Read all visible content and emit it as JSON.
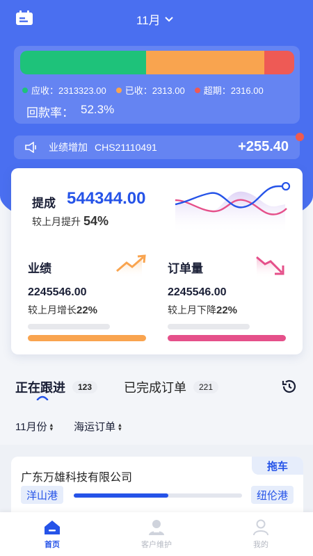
{
  "colors": {
    "primary": "#4a6ff0",
    "accent_blue": "#2553e8",
    "received_green": "#1ec27a",
    "done_orange": "#f9a44f",
    "overdue_red": "#ee5a55",
    "pink": "#e5508a"
  },
  "header": {
    "month_label": "11月",
    "calendar_icon": "calendar-icon",
    "dropdown_icon": "chevron-down-icon"
  },
  "summary": {
    "segments": [
      {
        "name": "应收",
        "value": 2313323.0,
        "display": "2313323.00",
        "color": "#1ec27a"
      },
      {
        "name": "已收",
        "value": 2313.0,
        "display": "2313.00",
        "color": "#f9a44f"
      },
      {
        "name": "超期",
        "value": 2316.0,
        "display": "2316.00",
        "color": "#ee5a55"
      }
    ],
    "bar_fractions": [
      0.46,
      0.43,
      0.11
    ],
    "legend": [
      {
        "label": "应收：",
        "value": "2313323.00",
        "color": "#1ec27a"
      },
      {
        "label": "已收：",
        "value": "2313.00",
        "color": "#f9a44f"
      },
      {
        "label": "超期：",
        "value": "2316.00",
        "color": "#ee5a55"
      }
    ],
    "rate_label": "回款率：",
    "rate_value": "52.3%"
  },
  "notice": {
    "text": "业绩增加",
    "code": "CHS21110491",
    "amount": "+255.40"
  },
  "commission": {
    "label": "提成",
    "value": "544344.00",
    "compare_label": "较上月提升",
    "compare_value": "54%"
  },
  "metrics": [
    {
      "title": "业绩",
      "value": "2245546.00",
      "compare_label": "较上月增长",
      "compare_value": "22%",
      "trend": "up",
      "fill_color": "#f9a44f"
    },
    {
      "title": "订单量",
      "value": "2245546.00",
      "compare_label": "较上月下降",
      "compare_value": "22%",
      "trend": "down",
      "fill_color": "#e5508a"
    }
  ],
  "tabs": [
    {
      "label": "正在跟进",
      "count": "123",
      "active": true
    },
    {
      "label": "已完成订单",
      "count": "221",
      "active": false
    }
  ],
  "filters": [
    {
      "label": "11月份"
    },
    {
      "label": "海运订单"
    }
  ],
  "order": {
    "company": "广东万雄科技有限公司",
    "type": "拖车",
    "origin": "洋山港",
    "destination": "纽伦港",
    "progress": 0.56
  },
  "nav": [
    {
      "label": "首页",
      "icon": "home-icon",
      "active": true
    },
    {
      "label": "客户维护",
      "icon": "customer-icon",
      "active": false
    },
    {
      "label": "我的",
      "icon": "profile-icon",
      "active": false
    }
  ]
}
